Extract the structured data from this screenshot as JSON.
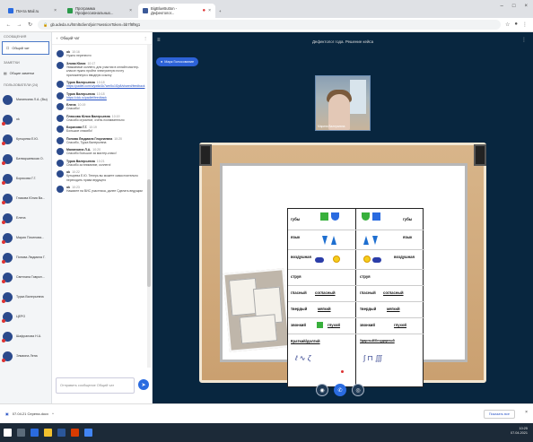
{
  "browser": {
    "tabs": [
      {
        "label": "Почта Mail.ru",
        "color": "#2a6be0"
      },
      {
        "label": "Программа Профессиональных...",
        "color": "#2a9a4a"
      },
      {
        "label": "BigBlueButton - Дефектолог...",
        "color": "#3b5998"
      }
    ],
    "url": "gb.adeda.ru/html5client/join?sessionToken=bb7f8f9g1",
    "window_controls": [
      "–",
      "□",
      "×"
    ]
  },
  "left_nav": {
    "messages_heading": "СООБЩЕНИЯ",
    "public_chat": "Общий чат",
    "notes_heading": "ЗАМЕТКИ",
    "shared_notes": "Общие заметки",
    "users_heading": "ПОЛЬЗОВАТЕЛИ (24)",
    "users": [
      "Малинкина Л.А. (Вы)",
      "ok",
      "Кутырева Е.Ю.",
      "Батваршевская О.",
      "Борисова Г.Г.",
      "Глазова Юлия Ва...",
      "Елена",
      "Мария Почепова...",
      "Попова Людмила Г.",
      "Светлана Гаврил...",
      "Турка Валерьевна",
      "ЦЕРО",
      "Шафранова Н.А.",
      "Эльвина Лена"
    ]
  },
  "chat": {
    "title": "Общий чат",
    "messages": [
      {
        "author": "ok",
        "time": "10:16",
        "text": "Нужно перенести"
      },
      {
        "author": "Злова Юлия",
        "time": "10:17",
        "text": "Уважаемые коллеги, для участия в онлайн мастер-классе нужно пройти электронную почту приложенную к вводную ссылку"
      },
      {
        "author": "Турка Валерьевна",
        "time": "10:18",
        "text": "https://padlet.com/u/yw6d1k7wm5u1f2p8/shared/feedback",
        "link": true
      },
      {
        "author": "Турка Валерьевна",
        "time": "10:18",
        "text": "https://clck.ru/padlet/feedback",
        "link": true
      },
      {
        "author": "Елена",
        "time": "10:19",
        "text": "Спасибо!"
      },
      {
        "author": "Плюсова Юлия Валерьевна",
        "time": "10:19",
        "text": "Спасибо огромное, очень познавательно"
      },
      {
        "author": "Борисова Г.Г.",
        "time": "10:19",
        "text": "Большое спасибо!"
      },
      {
        "author": "Попова Людмила Георгиевна",
        "time": "10:20",
        "text": "Спасибо, Турка Валерьевна"
      },
      {
        "author": "Малинкина Л.А.",
        "time": "10:20",
        "text": "Спасибо большое за мастер-класс!"
      },
      {
        "author": "Турка Валерьевна",
        "time": "10:21",
        "text": "Спасибо за внимание, коллеги!"
      },
      {
        "author": "ok",
        "time": "10:22",
        "text": "Кутырева Е.Ю. Теперь вы можете самостоятельно переходить права ведущего"
      },
      {
        "author": "ok",
        "time": "10:23",
        "text": "Нажмите на ВИС участника, далее Сделать ведущим"
      }
    ],
    "input_placeholder": "Отправить сообщение Общий чат"
  },
  "main": {
    "session_title": "Дефектолог года. Решение кейса",
    "recording_label": "Марк Голосование",
    "webcam_name": "Марина Валерьевна"
  },
  "slide": {
    "rows": [
      {
        "left": "губы",
        "right": "губы"
      },
      {
        "left": "язык",
        "right": "язык"
      },
      {
        "left": "воздушная",
        "right": "воздушная"
      },
      {
        "left": "струя",
        "right": "струя"
      },
      {
        "left": "гласный",
        "left2": "согласный",
        "right": "гласный",
        "right2": "согласный"
      },
      {
        "left": "твердый",
        "left2": "мягкий",
        "right": "твердый",
        "right2": "мягкий"
      },
      {
        "left": "звонкий",
        "left2": "глухой",
        "right": "звонкий",
        "right2": "глухой"
      },
      {
        "left": "Краткий/долгий",
        "right": "Ударный/безударный"
      }
    ]
  },
  "downloads": {
    "file": "07.04.21 Серена.docx",
    "show_all": "Показать все"
  },
  "taskbar": {
    "time": "10:25",
    "date": "07.04.2021"
  },
  "colors": {
    "main_bg": "#08263f",
    "accent": "#2a6be0",
    "avatar": "#2b4a8c"
  }
}
